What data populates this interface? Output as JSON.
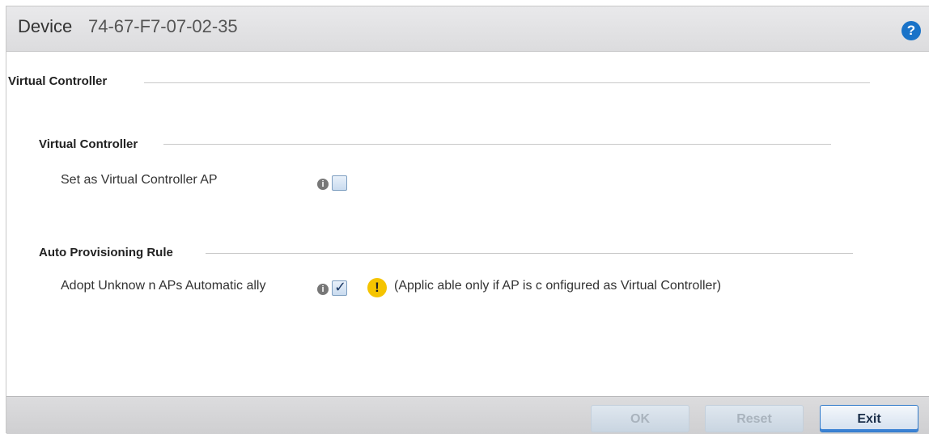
{
  "header": {
    "device_label": "Device",
    "device_id": "74-67-F7-07-02-35",
    "help_icon": "question-icon"
  },
  "main": {
    "section_title": "Virtual Controller",
    "virtual_controller": {
      "title": "Virtual Controller",
      "set_vc_label": "Set as Virtual Controller AP",
      "set_vc_checked": false
    },
    "auto_provisioning": {
      "title": "Auto Provisioning Rule",
      "adopt_label": "Adopt Unknow n APs Automatic ally",
      "adopt_checked": true,
      "note": "(Applic able only if AP is c onfigured as Virtual Controller)"
    }
  },
  "footer": {
    "ok_label": "OK",
    "reset_label": "Reset",
    "exit_label": "Exit"
  },
  "colors": {
    "accent": "#1a73c8",
    "warning": "#f5c400"
  }
}
